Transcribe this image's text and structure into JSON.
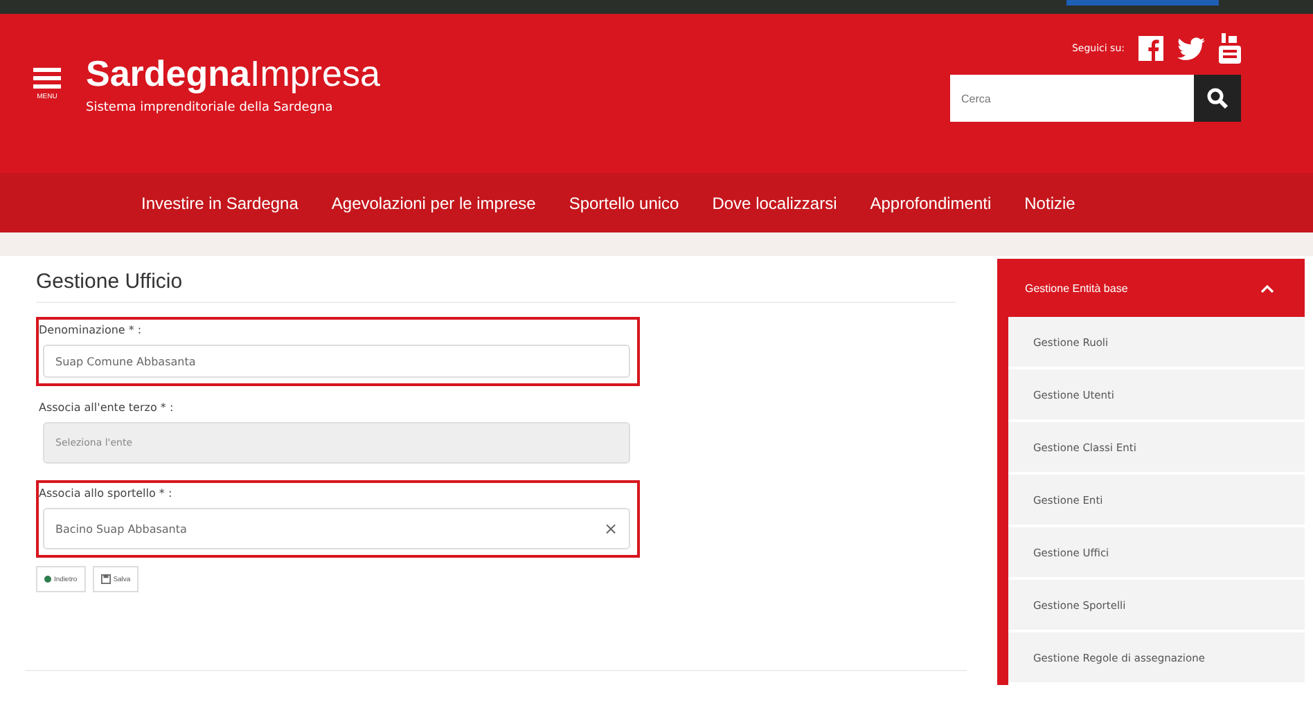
{
  "header": {
    "menu_label": "MENU",
    "logo": "**Sardegna**Impresa",
    "tagline": "Sistema imprenditoriale della Sardegna",
    "follow_label": "Seguici su:",
    "search": {
      "placeholder": "Cerca"
    }
  },
  "nav": [
    "Investire in Sardegna",
    "Agevolazioni per le imprese",
    "Sportello unico",
    "Dove localizzarsi",
    "Approfondimenti",
    "Notizie"
  ],
  "form": {
    "title": "Gestione Ufficio",
    "fields": [
      {
        "label": "Denominazione * :",
        "value": "Suap Comune Abbasanta",
        "kind": "input",
        "disabled": false,
        "highlighted": true
      },
      {
        "label": "Associa all'ente terzo * :",
        "placeholder": "Seleziona l'ente",
        "kind": "select",
        "disabled": true,
        "highlighted": false
      },
      {
        "label": "Associa allo sportello * :",
        "value": "Bacino Suap Abbasanta",
        "kind": "select",
        "clear": "×",
        "disabled": false,
        "highlighted": true
      }
    ],
    "buttons": [
      {
        "label": "Indietro",
        "kind": "back"
      },
      {
        "label": "Salva",
        "kind": "save"
      }
    ]
  },
  "sidebar": {
    "title": "Gestione Entità base",
    "expanded": true,
    "items": [
      "Gestione Ruoli",
      "Gestione Utenti",
      "Gestione Classi Enti",
      "Gestione Enti",
      "Gestione Uffici",
      "Gestione Sportelli",
      "Gestione Regole di assegnazione"
    ]
  }
}
